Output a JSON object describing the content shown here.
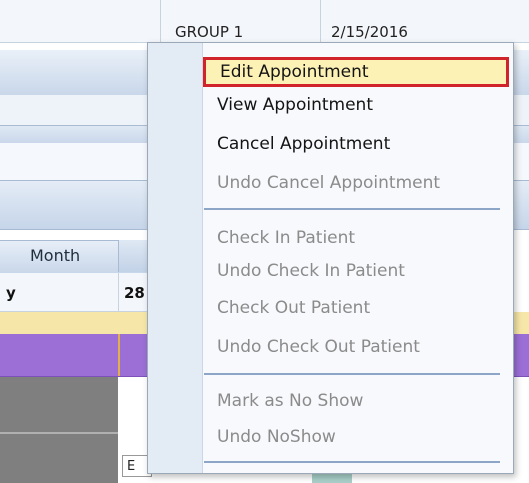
{
  "grid": {
    "group": "GROUP 1",
    "date": "2/15/2016"
  },
  "scheduler": {
    "view_label": "Month",
    "day_col_left": "y",
    "day_col_right": "28",
    "ghost_label": "E"
  },
  "context_menu": {
    "items": [
      {
        "label": "Edit Appointment",
        "enabled": true,
        "highlighted": true
      },
      {
        "label": "View Appointment",
        "enabled": true
      },
      {
        "label": "Cancel Appointment",
        "enabled": true
      },
      {
        "label": "Undo Cancel Appointment",
        "enabled": false
      },
      {
        "label": "Check In Patient",
        "enabled": false
      },
      {
        "label": "Undo Check In Patient",
        "enabled": false
      },
      {
        "label": "Check Out Patient",
        "enabled": false
      },
      {
        "label": "Undo Check Out Patient",
        "enabled": false
      },
      {
        "label": "Mark as No Show",
        "enabled": false
      },
      {
        "label": "Undo NoShow",
        "enabled": false
      }
    ]
  },
  "colors": {
    "highlight_border": "#d1232a",
    "highlight_fill": "#fdf2b6",
    "band_blue": "#c9d7ea",
    "appointment_yellow": "#f6e7a8",
    "appointment_purple": "#9b6fd6",
    "disabled_text": "#8b8b8b"
  }
}
